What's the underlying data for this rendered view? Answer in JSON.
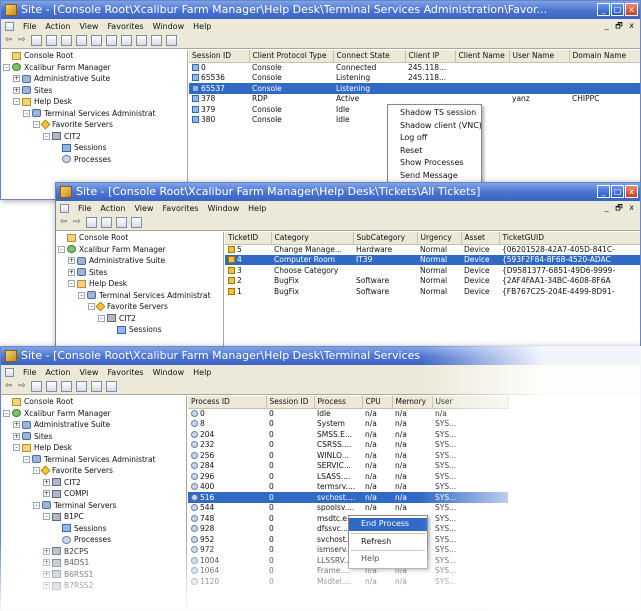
{
  "w1": {
    "title": "Site - [Console Root\\Xcalibur Farm Manager\\Help Desk\\Terminal Services Administration\\Favor...",
    "menu": [
      "File",
      "Action",
      "View",
      "Favorites",
      "Window",
      "Help"
    ],
    "mdi_controls": "_ 🗗 x",
    "tree": [
      {
        "label": "Console Root",
        "icon": "folder",
        "indent": 0,
        "exp": ""
      },
      {
        "label": "Xcalibur Farm Manager",
        "icon": "globe",
        "indent": 0,
        "exp": "-"
      },
      {
        "label": "Administrative Suite",
        "icon": "gear",
        "indent": 1,
        "exp": "+"
      },
      {
        "label": "Sites",
        "icon": "gear",
        "indent": 1,
        "exp": "+"
      },
      {
        "label": "Help Desk",
        "icon": "folder",
        "indent": 1,
        "exp": "-"
      },
      {
        "label": "Terminal Services Administrat",
        "icon": "gear",
        "indent": 2,
        "exp": "-"
      },
      {
        "label": "Favorite Servers",
        "icon": "star",
        "indent": 3,
        "exp": "-"
      },
      {
        "label": "CIT2",
        "icon": "server",
        "indent": 4,
        "exp": "-"
      },
      {
        "label": "Sessions",
        "icon": "screen",
        "indent": 5,
        "exp": ""
      },
      {
        "label": "Processes",
        "icon": "proc",
        "indent": 5,
        "exp": ""
      }
    ],
    "columns": [
      "Session ID",
      "Client Protocol Type",
      "Connect State",
      "Client IP",
      "Client Name",
      "User Name",
      "Domain Name"
    ],
    "rows": [
      [
        "0",
        "Console",
        "Connected",
        "245.118...",
        "",
        "",
        ""
      ],
      [
        "65536",
        "Console",
        "Listening",
        "245.118...",
        "",
        "",
        ""
      ],
      [
        "65537",
        "Console",
        "Listening",
        "",
        "",
        "",
        ""
      ],
      [
        "378",
        "RDP",
        "Active",
        "",
        "",
        "yanz",
        "CHIPPC"
      ],
      [
        "379",
        "Console",
        "Idle",
        "",
        "",
        "",
        ""
      ],
      [
        "380",
        "Console",
        "Idle",
        "",
        "",
        "",
        ""
      ]
    ],
    "context_menu": [
      "Shadow TS session",
      "Shadow client (VNC)",
      "Log off",
      "Reset",
      "Show Processes",
      "Send Message"
    ]
  },
  "w2": {
    "title": "Site - [Console Root\\Xcalibur Farm Manager\\Help Desk\\Tickets\\All Tickets]",
    "menu": [
      "File",
      "Action",
      "View",
      "Favorites",
      "Window",
      "Help"
    ],
    "mdi_controls": "_ 🗗 x",
    "tree": [
      {
        "label": "Console Root",
        "icon": "folder",
        "indent": 0,
        "exp": ""
      },
      {
        "label": "Xcalibur Farm Manager",
        "icon": "globe",
        "indent": 0,
        "exp": "-"
      },
      {
        "label": "Administrative Suite",
        "icon": "gear",
        "indent": 1,
        "exp": "+"
      },
      {
        "label": "Sites",
        "icon": "gear",
        "indent": 1,
        "exp": "+"
      },
      {
        "label": "Help Desk",
        "icon": "folder",
        "indent": 1,
        "exp": "-"
      },
      {
        "label": "Terminal Services Administrat",
        "icon": "gear",
        "indent": 2,
        "exp": "-"
      },
      {
        "label": "Favorite Servers",
        "icon": "star",
        "indent": 3,
        "exp": "-"
      },
      {
        "label": "CIT2",
        "icon": "server",
        "indent": 4,
        "exp": "-"
      },
      {
        "label": "Sessions",
        "icon": "screen",
        "indent": 5,
        "exp": ""
      }
    ],
    "columns": [
      "TicketID",
      "Category",
      "SubCategory",
      "Urgency",
      "Asset",
      "TicketGUID"
    ],
    "rows": [
      [
        "5",
        "Change Manage...",
        "Hardware",
        "Normal",
        "Device",
        "{06201528-42A7-405D-841C-"
      ],
      [
        "4",
        "Computer Room",
        "IT39",
        "Normal",
        "Device",
        "{593F2F84-8F68-4520-ADAC"
      ],
      [
        "3",
        "Choose Category",
        "",
        "Normal",
        "Device",
        "{D9581377-6851-49D6-9999-"
      ],
      [
        "2",
        "BugFix",
        "Software",
        "Normal",
        "Device",
        "{2AF4FAA1-34BC-4608-8F6A"
      ],
      [
        "1",
        "BugFix",
        "Software",
        "Normal",
        "Device",
        "{FB767C25-204E-4499-8D91-"
      ]
    ]
  },
  "w3": {
    "title": "Site - [Console Root\\Xcalibur Farm Manager\\Help Desk\\Terminal Services",
    "menu": [
      "File",
      "Action",
      "View",
      "Favorites",
      "Window",
      "Help"
    ],
    "tree": [
      {
        "label": "Console Root",
        "icon": "folder",
        "indent": 0,
        "exp": ""
      },
      {
        "label": "Xcalibur Farm Manager",
        "icon": "globe",
        "indent": 0,
        "exp": "-"
      },
      {
        "label": "Administrative Suite",
        "icon": "gear",
        "indent": 1,
        "exp": "+"
      },
      {
        "label": "Sites",
        "icon": "gear",
        "indent": 1,
        "exp": "+"
      },
      {
        "label": "Help Desk",
        "icon": "folder",
        "indent": 1,
        "exp": "-"
      },
      {
        "label": "Terminal Services Administrat",
        "icon": "gear",
        "indent": 2,
        "exp": "-"
      },
      {
        "label": "Favorite Servers",
        "icon": "star",
        "indent": 3,
        "exp": "-"
      },
      {
        "label": "CIT2",
        "icon": "server",
        "indent": 4,
        "exp": "+"
      },
      {
        "label": "COMPI",
        "icon": "server",
        "indent": 4,
        "exp": "+"
      },
      {
        "label": "Terminal Servers",
        "icon": "gear",
        "indent": 3,
        "exp": "-"
      },
      {
        "label": "B1PC",
        "icon": "server",
        "indent": 4,
        "exp": "-"
      },
      {
        "label": "Sessions",
        "icon": "screen",
        "indent": 5,
        "exp": ""
      },
      {
        "label": "Processes",
        "icon": "proc",
        "indent": 5,
        "exp": ""
      },
      {
        "label": "B2CPS",
        "icon": "server",
        "indent": 4,
        "exp": "+"
      },
      {
        "label": "B4DS1",
        "icon": "server",
        "indent": 4,
        "exp": "+"
      },
      {
        "label": "B6RSS1",
        "icon": "server",
        "indent": 4,
        "exp": "+"
      },
      {
        "label": "B7RSS2",
        "icon": "server",
        "indent": 4,
        "exp": "+"
      }
    ],
    "columns": [
      "Process ID",
      "Session ID",
      "Process",
      "CPU",
      "Memory",
      "User"
    ],
    "rows": [
      [
        "0",
        "0",
        "Idle",
        "n/a",
        "n/a",
        "n/a"
      ],
      [
        "8",
        "0",
        "System",
        "n/a",
        "n/a",
        "SYS..."
      ],
      [
        "204",
        "0",
        "SMSS.E...",
        "n/a",
        "n/a",
        "SYS..."
      ],
      [
        "232",
        "0",
        "CSRSS....",
        "n/a",
        "n/a",
        "SYS..."
      ],
      [
        "256",
        "0",
        "WINLO...",
        "n/a",
        "n/a",
        "SYS..."
      ],
      [
        "284",
        "0",
        "SERVIC...",
        "n/a",
        "n/a",
        "SYS..."
      ],
      [
        "296",
        "0",
        "LSASS....",
        "n/a",
        "n/a",
        "SYS..."
      ],
      [
        "400",
        "0",
        "termsrv....",
        "n/a",
        "n/a",
        "SYS..."
      ],
      [
        "516",
        "0",
        "svchost....",
        "n/a",
        "n/a",
        "SYS..."
      ],
      [
        "544",
        "0",
        "spoolsv....",
        "n/a",
        "n/a",
        "SYS..."
      ],
      [
        "748",
        "0",
        "msdtc.e...",
        "n/a",
        "n/a",
        "SYS..."
      ],
      [
        "928",
        "0",
        "dfssvc....",
        "n/a",
        "n/a",
        "SYS..."
      ],
      [
        "952",
        "0",
        "svchost....",
        "n/a",
        "n/a",
        "SYS..."
      ],
      [
        "972",
        "0",
        "ismserv....",
        "n/a",
        "n/a",
        "SYS..."
      ],
      [
        "1004",
        "0",
        "LLSSRV....",
        "n/a",
        "n/a",
        "SYS..."
      ],
      [
        "1064",
        "0",
        "Frame....",
        "n/a",
        "n/a",
        "SYS..."
      ],
      [
        "1120",
        "0",
        "Msdtel....",
        "n/a",
        "n/a",
        "SYS..."
      ]
    ],
    "context_menu": [
      "End Process",
      "Refresh",
      "Help"
    ]
  }
}
